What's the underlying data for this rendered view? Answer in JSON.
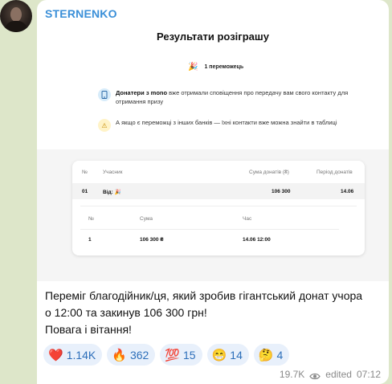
{
  "channel": {
    "name": "STERNENKO"
  },
  "image": {
    "title": "Результати розіграшу",
    "winners_icon": "🎉",
    "winners_count": "1 переможець",
    "note1_icon": "phone-icon",
    "note1_bold": "Донатери з mono",
    "note1_text": " вже отримали сповіщення про передачу вам свого контакту для отримання призу",
    "note2_icon": "⚠",
    "note2_text": "А якщо є переможці з інших банків — їхні контакти вже можна знайти в таблиці",
    "table": {
      "headers": [
        "№",
        "Учасник",
        "Сума донатів (₴)",
        "Період донатів"
      ],
      "row": {
        "num": "01",
        "participant": "Від: 🎉",
        "sum": "106 300",
        "period": "14.06"
      },
      "inner_headers": [
        "№",
        "Сума",
        "Час"
      ],
      "inner_row": {
        "num": "1",
        "sum": "106 300 ₴",
        "time": "14.06 12:00"
      }
    }
  },
  "caption": {
    "line1": "Переміг благодійник/ця, який зробив гігантський донат учора",
    "line2": "о 12:00 та закинув 106 300 грн!",
    "line3": "Повага і вітання!"
  },
  "reactions": [
    {
      "emoji": "❤️",
      "count": "1.14K"
    },
    {
      "emoji": "🔥",
      "count": "362"
    },
    {
      "emoji": "💯",
      "count": "15"
    },
    {
      "emoji": "😁",
      "count": "14"
    },
    {
      "emoji": "🤔",
      "count": "4"
    }
  ],
  "meta": {
    "views": "19.7K",
    "edited": "edited",
    "time": "07:12"
  }
}
